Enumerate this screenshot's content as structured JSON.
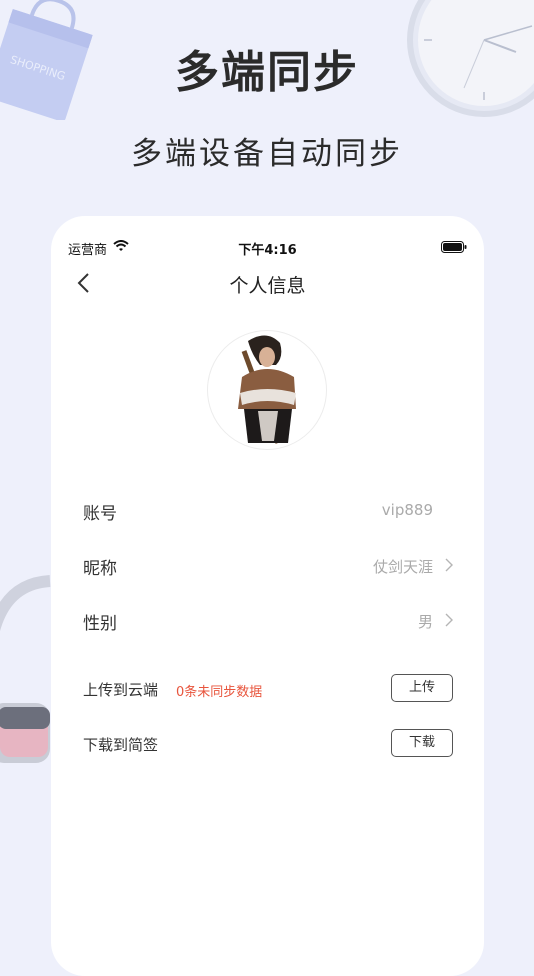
{
  "hero": {
    "title": "多端同步",
    "subtitle": "多端设备自动同步"
  },
  "decor": {
    "bag_text": "SHOPPING"
  },
  "statusbar": {
    "carrier": "运营商",
    "time": "下午4:16"
  },
  "navbar": {
    "title": "个人信息"
  },
  "profile": {
    "rows": [
      {
        "label": "账号",
        "value": "vip889"
      },
      {
        "label": "昵称",
        "value": "仗剑天涯"
      },
      {
        "label": "性别",
        "value": "男"
      }
    ]
  },
  "sync": {
    "upload": {
      "label": "上传到云端",
      "badge": "0条未同步数据",
      "button": "上传"
    },
    "download": {
      "label": "下载到简签",
      "button": "下载"
    }
  },
  "colors": {
    "background": "#eef0fb",
    "card": "#ffffff",
    "accent_red": "#e8553d",
    "muted_text": "#aaaaaa"
  }
}
